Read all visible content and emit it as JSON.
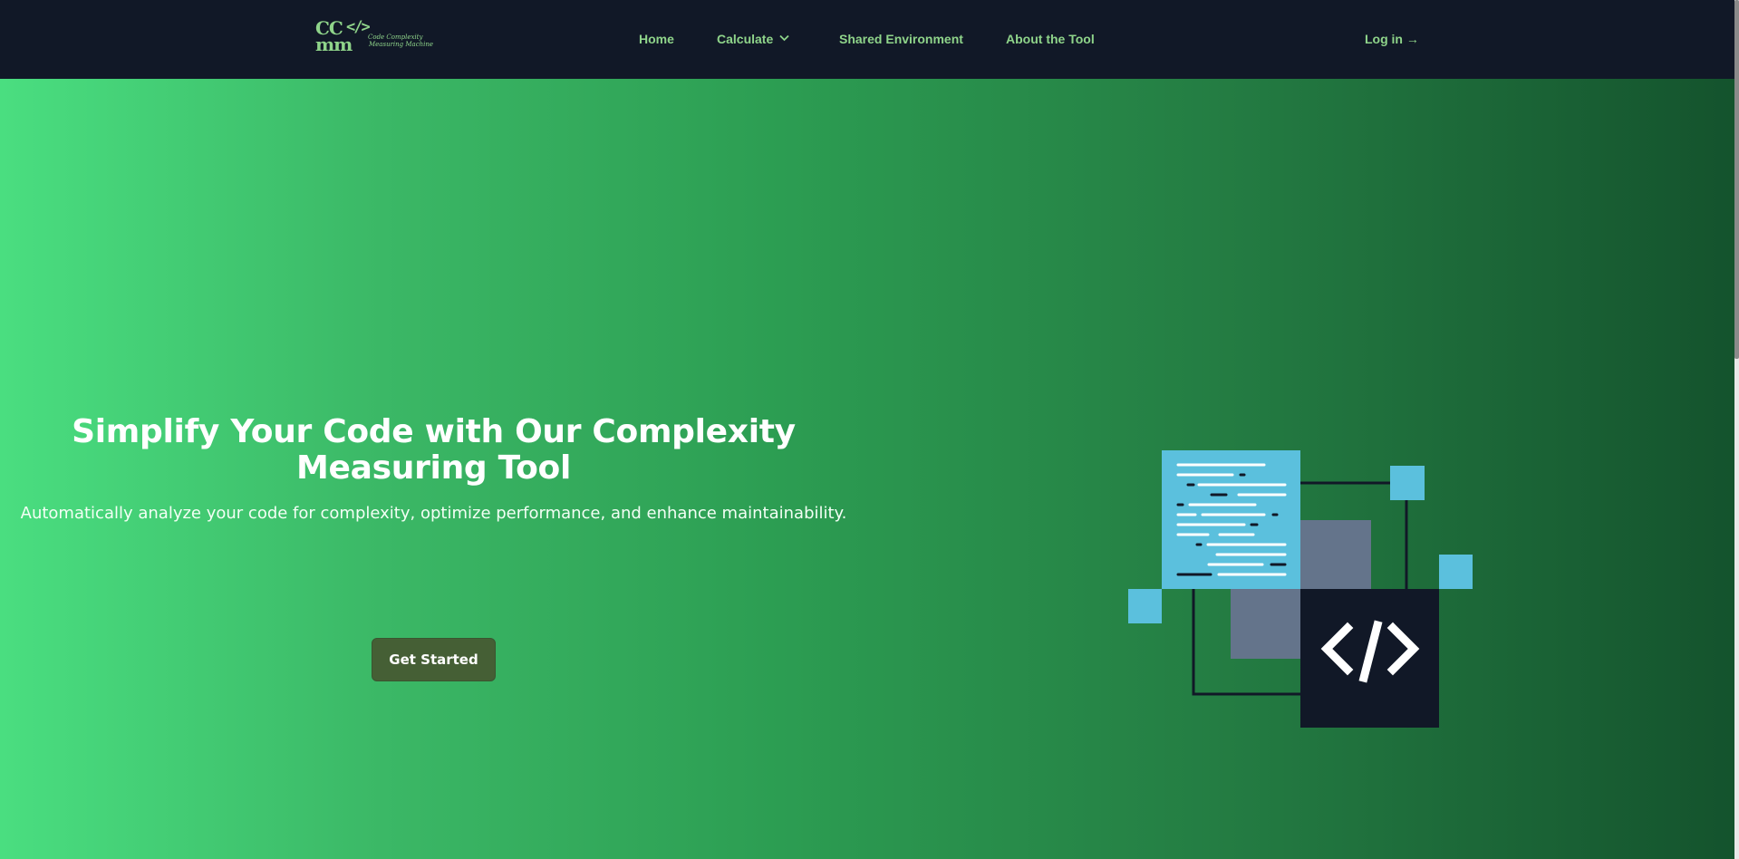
{
  "brand": {
    "logo_mark": [
      "CC",
      "mm"
    ],
    "logo_glyph": "</>",
    "logo_words": [
      "Code Complexity",
      "Measuring Machine"
    ]
  },
  "nav": {
    "home": "Home",
    "calculate": "Calculate",
    "shared_environment": "Shared Environment",
    "about": "About the Tool",
    "login": "Log in →"
  },
  "hero": {
    "title": "Simplify Your Code with Our Complexity Measuring Tool",
    "subtitle": "Automatically analyze your code for complexity, optimize performance, and enhance maintainability.",
    "cta_label": "Get Started"
  },
  "colors": {
    "navbar_bg": "#111827",
    "nav_text": "#8fd48a",
    "hero_gradient_start": "#4ade80",
    "hero_gradient_end": "#14532d",
    "cta_bg": "#455f35",
    "illustration_accent": "#5bc0dd",
    "illustration_dark": "#111827",
    "illustration_gray": "#64748b"
  },
  "icons": {
    "calculate_dropdown": "chevron-down-icon",
    "illustration_badge": "code-brackets-icon"
  }
}
